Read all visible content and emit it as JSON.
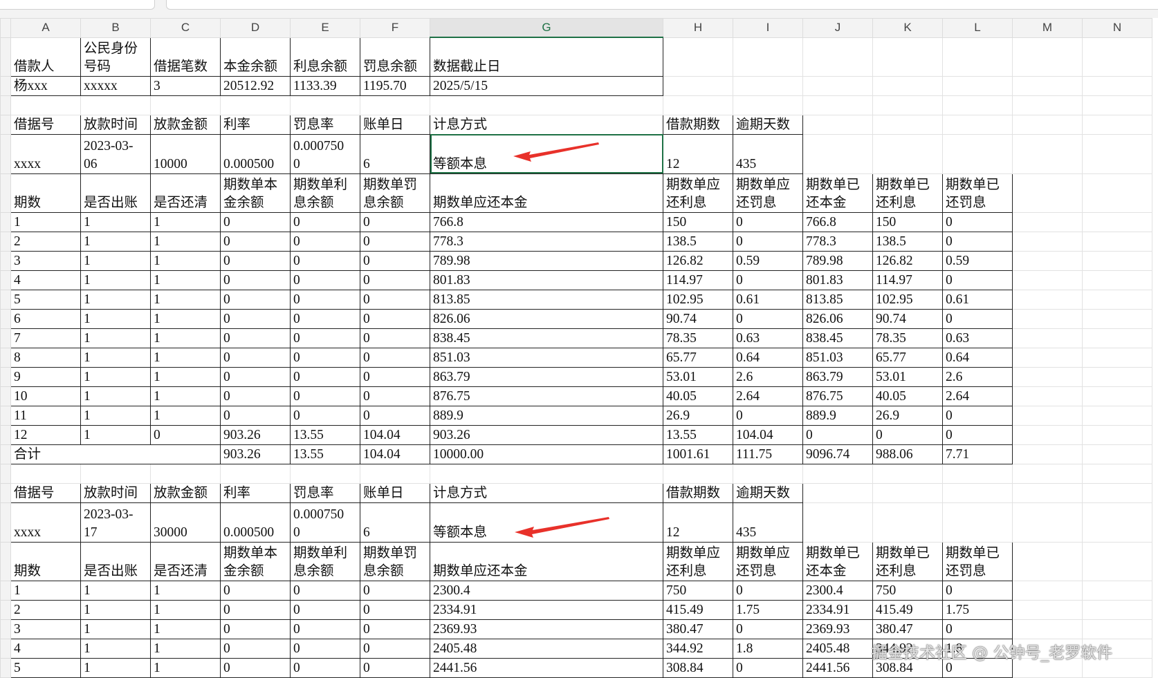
{
  "columns": [
    "A",
    "B",
    "C",
    "D",
    "E",
    "F",
    "G",
    "H",
    "I",
    "J",
    "K",
    "L",
    "M",
    "N"
  ],
  "selected_column": "G",
  "rows": [
    {
      "h": 56,
      "span": 7,
      "cells": [
        "借款人",
        "公民身份\n号码",
        "借据笔数",
        "本金余额",
        "利息余额",
        "罚息余额",
        "数据截止日"
      ]
    },
    {
      "h": 28,
      "span": 7,
      "cells": [
        "杨xxx",
        "xxxxx",
        "3",
        "20512.92",
        "1133.39",
        "1195.70",
        "2025/5/15"
      ]
    },
    {
      "h": 28,
      "span": 0,
      "cells": []
    },
    {
      "h": 28,
      "span": 9,
      "cells": [
        "借据号",
        "放款时间",
        "放款金额",
        "利率",
        "罚息率",
        "账单日",
        "计息方式",
        "借款期数",
        "逾期天数"
      ]
    },
    {
      "h": 57,
      "span": 9,
      "sel": 6,
      "cells": [
        "xxxx",
        "2023-03-\n06",
        "10000",
        "0.000500",
        "0.000750\n0",
        "6",
        "等额本息",
        "12",
        "435"
      ]
    },
    {
      "h": 56,
      "span": 12,
      "cells": [
        "期数",
        "是否出账",
        "是否还清",
        "期数单本\n金余额",
        "期数单利\n息余额",
        "期数单罚\n息余额",
        "期数单应还本金",
        "期数单应\n还利息",
        "期数单应\n还罚息",
        "期数单已\n还本金",
        "期数单已\n还利息",
        "期数单已\n还罚息"
      ]
    },
    {
      "h": 28,
      "span": 12,
      "cells": [
        "1",
        "1",
        "1",
        "0",
        "0",
        "0",
        "766.8",
        "150",
        "0",
        "766.8",
        "150",
        "0"
      ]
    },
    {
      "h": 28,
      "span": 12,
      "cells": [
        "2",
        "1",
        "1",
        "0",
        "0",
        "0",
        "778.3",
        "138.5",
        "0",
        "778.3",
        "138.5",
        "0"
      ]
    },
    {
      "h": 28,
      "span": 12,
      "cells": [
        "3",
        "1",
        "1",
        "0",
        "0",
        "0",
        "789.98",
        "126.82",
        "0.59",
        "789.98",
        "126.82",
        "0.59"
      ]
    },
    {
      "h": 28,
      "span": 12,
      "cells": [
        "4",
        "1",
        "1",
        "0",
        "0",
        "0",
        "801.83",
        "114.97",
        "0",
        "801.83",
        "114.97",
        "0"
      ]
    },
    {
      "h": 28,
      "span": 12,
      "cells": [
        "5",
        "1",
        "1",
        "0",
        "0",
        "0",
        "813.85",
        "102.95",
        "0.61",
        "813.85",
        "102.95",
        "0.61"
      ]
    },
    {
      "h": 28,
      "span": 12,
      "cells": [
        "6",
        "1",
        "1",
        "0",
        "0",
        "0",
        "826.06",
        "90.74",
        "0",
        "826.06",
        "90.74",
        "0"
      ]
    },
    {
      "h": 28,
      "span": 12,
      "cells": [
        "7",
        "1",
        "1",
        "0",
        "0",
        "0",
        "838.45",
        "78.35",
        "0.63",
        "838.45",
        "78.35",
        "0.63"
      ]
    },
    {
      "h": 28,
      "span": 12,
      "cells": [
        "8",
        "1",
        "1",
        "0",
        "0",
        "0",
        "851.03",
        "65.77",
        "0.64",
        "851.03",
        "65.77",
        "0.64"
      ]
    },
    {
      "h": 28,
      "span": 12,
      "cells": [
        "9",
        "1",
        "1",
        "0",
        "0",
        "0",
        "863.79",
        "53.01",
        "2.6",
        "863.79",
        "53.01",
        "2.6"
      ]
    },
    {
      "h": 28,
      "span": 12,
      "cells": [
        "10",
        "1",
        "1",
        "0",
        "0",
        "0",
        "876.75",
        "40.05",
        "2.64",
        "876.75",
        "40.05",
        "2.64"
      ]
    },
    {
      "h": 28,
      "span": 12,
      "cells": [
        "11",
        "1",
        "1",
        "0",
        "0",
        "0",
        "889.9",
        "26.9",
        "0",
        "889.9",
        "26.9",
        "0"
      ]
    },
    {
      "h": 28,
      "span": 12,
      "cells": [
        "12",
        "1",
        "0",
        "903.26",
        "13.55",
        "104.04",
        "903.26",
        "13.55",
        "104.04",
        "0",
        "0",
        "0"
      ]
    },
    {
      "h": 28,
      "span": 12,
      "merge3": true,
      "cells": [
        "合计",
        "903.26",
        "13.55",
        "104.04",
        "10000.00",
        "1001.61",
        "111.75",
        "9096.74",
        "988.06",
        "7.71"
      ]
    },
    {
      "h": 28,
      "span": 0,
      "cells": []
    },
    {
      "h": 28,
      "span": 9,
      "cells": [
        "借据号",
        "放款时间",
        "放款金额",
        "利率",
        "罚息率",
        "账单日",
        "计息方式",
        "借款期数",
        "逾期天数"
      ]
    },
    {
      "h": 57,
      "span": 9,
      "cells": [
        "xxxx",
        "2023-03-\n17",
        "30000",
        "0.000500",
        "0.000750\n0",
        "6",
        "等额本息",
        "12",
        "435"
      ]
    },
    {
      "h": 56,
      "span": 12,
      "cells": [
        "期数",
        "是否出账",
        "是否还清",
        "期数单本\n金余额",
        "期数单利\n息余额",
        "期数单罚\n息余额",
        "期数单应还本金",
        "期数单应\n还利息",
        "期数单应\n还罚息",
        "期数单已\n还本金",
        "期数单已\n还利息",
        "期数单已\n还罚息"
      ]
    },
    {
      "h": 28,
      "span": 12,
      "cells": [
        "1",
        "1",
        "1",
        "0",
        "0",
        "0",
        "2300.4",
        "750",
        "0",
        "2300.4",
        "750",
        "0"
      ]
    },
    {
      "h": 28,
      "span": 12,
      "cells": [
        "2",
        "1",
        "1",
        "0",
        "0",
        "0",
        "2334.91",
        "415.49",
        "1.75",
        "2334.91",
        "415.49",
        "1.75"
      ]
    },
    {
      "h": 28,
      "span": 12,
      "cells": [
        "3",
        "1",
        "1",
        "0",
        "0",
        "0",
        "2369.93",
        "380.47",
        "0",
        "2369.93",
        "380.47",
        "0"
      ]
    },
    {
      "h": 28,
      "span": 12,
      "cells": [
        "4",
        "1",
        "1",
        "0",
        "0",
        "0",
        "2405.48",
        "344.92",
        "1.8",
        "2405.48",
        "344.92",
        "1.8"
      ]
    },
    {
      "h": 28,
      "span": 12,
      "cells": [
        "5",
        "1",
        "1",
        "0",
        "0",
        "0",
        "2441.56",
        "308.84",
        "0",
        "2441.56",
        "308.84",
        "0"
      ]
    }
  ],
  "watermark": "掘金技术社区 @ 公钟号_老罗软件",
  "colors": {
    "selection": "#1e7145",
    "arrow": "#e8312a"
  }
}
